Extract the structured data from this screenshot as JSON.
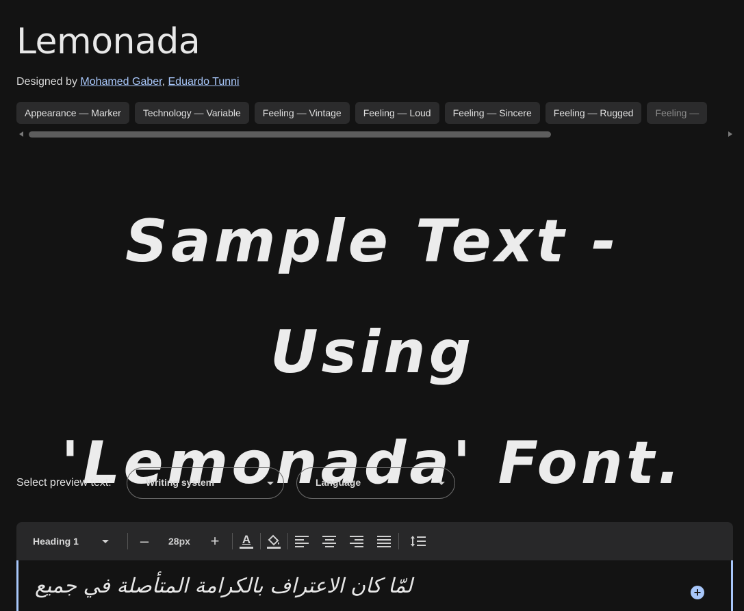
{
  "font": {
    "name": "Lemonada",
    "designed_by_label": "Designed by",
    "designers": [
      "Mohamed Gaber",
      "Eduardo Tunni"
    ],
    "designer_separator": ","
  },
  "tags": [
    "Appearance — Marker",
    "Technology — Variable",
    "Feeling — Vintage",
    "Feeling — Loud",
    "Feeling — Sincere",
    "Feeling — Rugged",
    "Feeling —"
  ],
  "sample": {
    "line1": "Sample Text - Using",
    "line2": "'Lemonada' Font."
  },
  "preview": {
    "label": "Select preview text:",
    "writing_system": "Writing system",
    "language": "Language"
  },
  "toolbar": {
    "style": "Heading 1",
    "decrease": "–",
    "size": "28px",
    "increase": "+",
    "text_color_glyph": "A"
  },
  "editor": {
    "text": "لمّا كان الاعتراف بالكرامة المتأصلة في جميع",
    "add_glyph": "+"
  },
  "colors": {
    "background": "#131313",
    "link": "#a8c7fa",
    "chip": "#2b2b2c",
    "toolbar": "#282829"
  }
}
